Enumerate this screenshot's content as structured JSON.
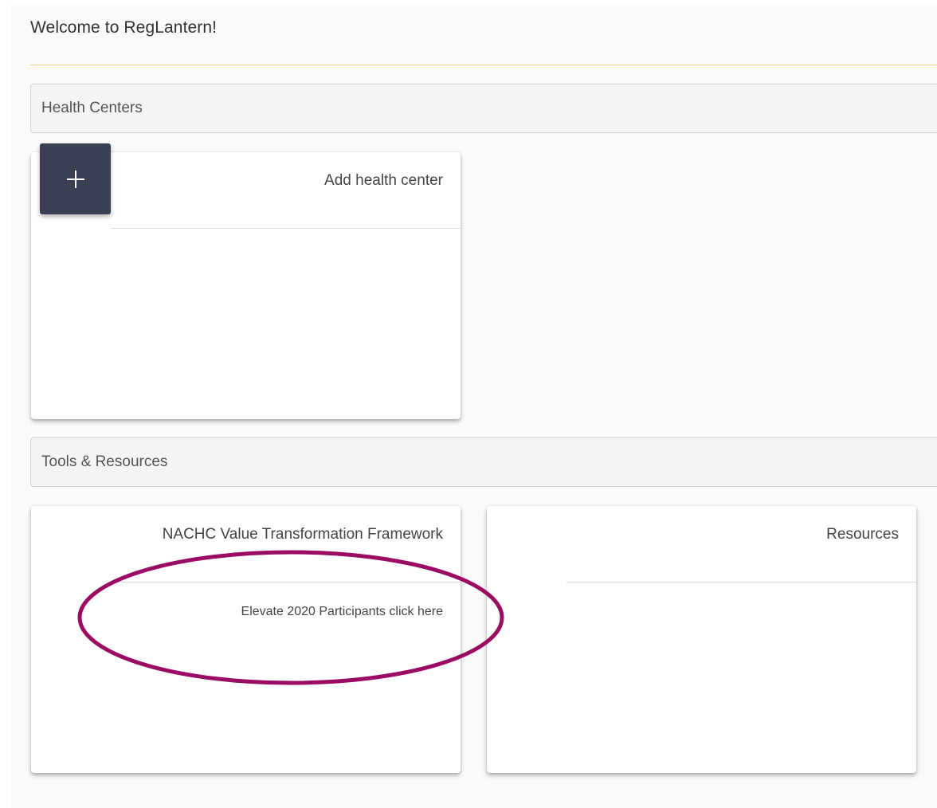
{
  "header": {
    "welcome_text": "Welcome to RegLantern!"
  },
  "sections": {
    "health_centers": {
      "title": "Health Centers",
      "add_card": {
        "title": "Add health center",
        "add_icon": "plus-icon"
      }
    },
    "tools_resources": {
      "title": "Tools & Resources",
      "cards": [
        {
          "title": "NACHC Value Transformation Framework",
          "link_text": "Elevate 2020 Participants click here"
        },
        {
          "title": "Resources"
        }
      ]
    }
  },
  "colors": {
    "accent_divider": "#f1d48a",
    "add_button_bg": "#3a3f52",
    "annotation_ellipse": "#9b0a63"
  }
}
